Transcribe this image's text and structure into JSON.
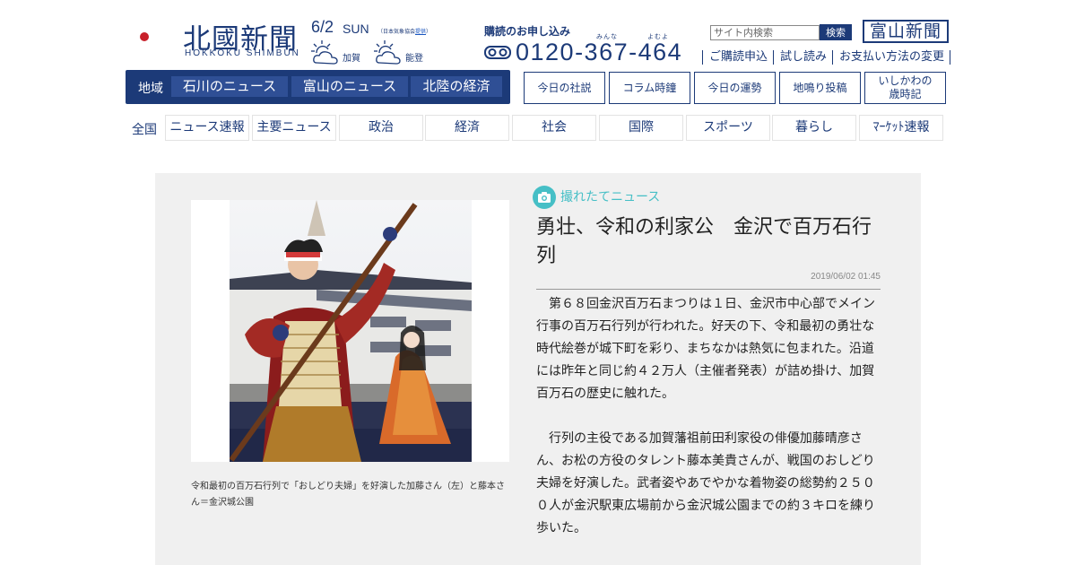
{
  "header": {
    "logo_title": "北國新聞",
    "logo_subtitle": "HOKKOKU SHIMBUN",
    "date": "6/2",
    "weekday": "SUN",
    "weather_note_prefix": "（日本気象協会",
    "weather_note_link": "提供",
    "weather_note_suffix": "）",
    "weather": [
      {
        "area": "加賀",
        "icon": "sun-cloud-icon"
      },
      {
        "area": "能登",
        "icon": "sun-cloud-icon"
      }
    ],
    "subscribe_label": "購読のお申し込み",
    "subscribe_ruby_1": "みんな",
    "subscribe_ruby_2": "よむよ",
    "phone": "0120-367-464",
    "search_placeholder": "サイト内検索",
    "search_button": "検索",
    "toyama_button": "富山新聞",
    "links": [
      "ご購読申込",
      "試し読み",
      "お支払い方法の変更"
    ]
  },
  "region_nav": {
    "label": "地域",
    "tabs": [
      "石川のニュース",
      "富山のニュース",
      "北陸の経済"
    ]
  },
  "column_nav": [
    {
      "label": "今日の社説"
    },
    {
      "label": "コラム時鐘"
    },
    {
      "label": "今日の運勢"
    },
    {
      "label": "地鳴り投稿"
    },
    {
      "line1": "いしかわの",
      "line2": "歳時記"
    }
  ],
  "category_nav": {
    "label": "全国",
    "items": [
      "ニュース速報",
      "主要ニュース",
      "政治",
      "経済",
      "社会",
      "国際",
      "スポーツ",
      "暮らし",
      "ﾏｰｹｯﾄ速報"
    ]
  },
  "article": {
    "badge": "撮れたてニュース",
    "headline": "勇壮、令和の利家公　金沢で百万石行列",
    "timestamp": "2019/06/02 01:45",
    "caption": "令和最初の百万石行列で「おしどり夫婦」を好演した加藤さん（左）と藤本さん＝金沢城公園",
    "paragraphs": [
      "第６８回金沢百万石まつりは１日、金沢市中心部でメイン行事の百万石行列が行われた。好天の下、令和最初の勇壮な時代絵巻が城下町を彩り、まちなかは熱気に包まれた。沿道には昨年と同じ約４２万人（主催者発表）が詰め掛け、加賀百万石の歴史に触れた。",
      "行列の主役である加賀藩祖前田利家役の俳優加藤晴彦さん、お松の方役のタレント藤本美貴さんが、戦国のおしどり夫婦を好演した。武者姿やあでやかな着物姿の総勢約２５００人が金沢駅東広場前から金沢城公園までの約３キロを練り歩いた。"
    ]
  },
  "colors": {
    "brand_navy": "#1c3a78",
    "logo_red": "#c8202a",
    "logo_orange": "#e6841d",
    "badge_teal": "#46bfc6",
    "article_bg": "#f0f0f0"
  }
}
